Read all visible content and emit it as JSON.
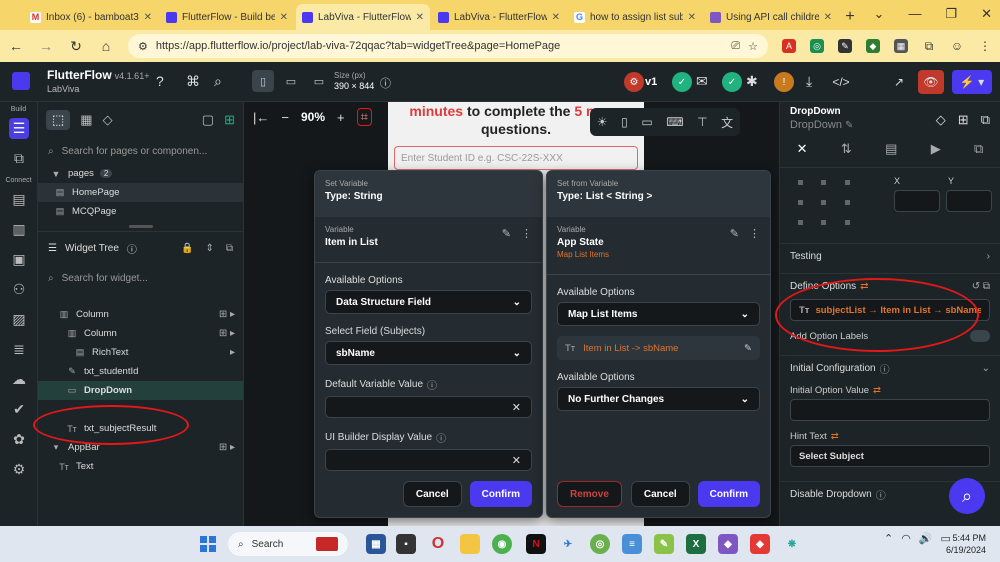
{
  "browser": {
    "tabs": [
      {
        "label": "Inbox (6) - bamboat3",
        "color": "#d93025",
        "letter": "M"
      },
      {
        "label": "FlutterFlow - Build be",
        "color": "#4b39ef",
        "letter": "F"
      },
      {
        "label": "LabViva - FlutterFlow",
        "color": "#4b39ef",
        "letter": "F"
      },
      {
        "label": "LabViva - FlutterFlow",
        "color": "#4b39ef",
        "letter": "F"
      },
      {
        "label": "how to assign list sub",
        "color": "#4285f4",
        "letter": "G"
      },
      {
        "label": "Using API call childre",
        "color": "#4b39ef",
        "letter": "F"
      }
    ],
    "url": "https://app.flutterflow.io/project/lab-viva-72qqac?tab=widgetTree&page=HomePage",
    "accent": "#f6d66b"
  },
  "topbar": {
    "brand": "FlutterFlow",
    "version": "v4.1.61+",
    "project": "LabViva",
    "size_label": "Size (px)",
    "size_value": "390 × 844",
    "version_badge": "v1"
  },
  "rail": {
    "build_label": "Build",
    "connect_label": "Connect"
  },
  "left_panel": {
    "page_search_placeholder": "Search for pages or componen...",
    "pages_label": "pages",
    "pages_count": "2",
    "pages": [
      "HomePage",
      "MCQPage"
    ],
    "widget_tree_label": "Widget Tree",
    "widget_search_placeholder": "Search for widget...",
    "tree": [
      {
        "label": "Column",
        "icon": "column-icon"
      },
      {
        "label": "Column",
        "icon": "column-icon"
      },
      {
        "label": "RichText",
        "icon": "richtext-icon"
      },
      {
        "label": "txt_studentId",
        "icon": "textfield-icon"
      },
      {
        "label": "DropDown",
        "icon": "dropdown-icon"
      },
      {
        "label": "",
        "icon": ""
      },
      {
        "label": "txt_subjectResult",
        "icon": "text-icon"
      },
      {
        "label": "AppBar",
        "icon": "appbar-icon"
      },
      {
        "label": "Text",
        "icon": "text-icon"
      }
    ]
  },
  "canvas": {
    "zoom": "90%",
    "phone_title_red1": "minutes",
    "phone_title_mid": " to complete the ",
    "phone_title_red2": "5 mcqs",
    "phone_title_line2": "questions.",
    "phone_input_placeholder": "Enter Student ID e.g. CSC-22S-XXX"
  },
  "dialog_left": {
    "header_sub": "Set Variable",
    "header_title": "Type: String",
    "var_label": "Variable",
    "var_name": "Item in List",
    "available_options_label": "Available Options",
    "available_options_value": "Data Structure Field",
    "select_field_label": "Select Field (Subjects)",
    "select_field_value": "sbName",
    "default_value_label": "Default Variable Value",
    "ui_builder_label": "UI Builder Display Value",
    "cancel": "Cancel",
    "confirm": "Confirm"
  },
  "dialog_right": {
    "header_sub": "Set from Variable",
    "header_title": "Type: List < String >",
    "var_label": "Variable",
    "var_name": "App State",
    "var_sub": "Map List Items",
    "available_options_label": "Available Options",
    "available_options_value": "Map List Items",
    "binding_text": "Item in List -> sbName",
    "available_options2_label": "Available Options",
    "available_options2_value": "No Further Changes",
    "remove": "Remove",
    "cancel": "Cancel",
    "confirm": "Confirm"
  },
  "right_panel": {
    "widget_type": "DropDown",
    "widget_name": "DropDown",
    "x_label": "X",
    "y_label": "Y",
    "testing_label": "Testing",
    "define_options_label": "Define Options",
    "define_options_value": "subjectList → Item in List → sbName",
    "add_option_labels": "Add Option Labels",
    "initial_config_label": "Initial Configuration",
    "initial_option_label": "Initial Option Value",
    "hint_text_label": "Hint Text",
    "hint_text_value": "Select Subject",
    "disable_dropdown_label": "Disable Dropdown"
  },
  "taskbar": {
    "search_label": "Search",
    "time": "5:44 PM",
    "date": "6/19/2024"
  },
  "colors": {
    "bg": "#14181b",
    "panel": "#1d2428",
    "primary": "#4b39ef",
    "orange": "#e0742d",
    "annotation": "#e41818"
  }
}
